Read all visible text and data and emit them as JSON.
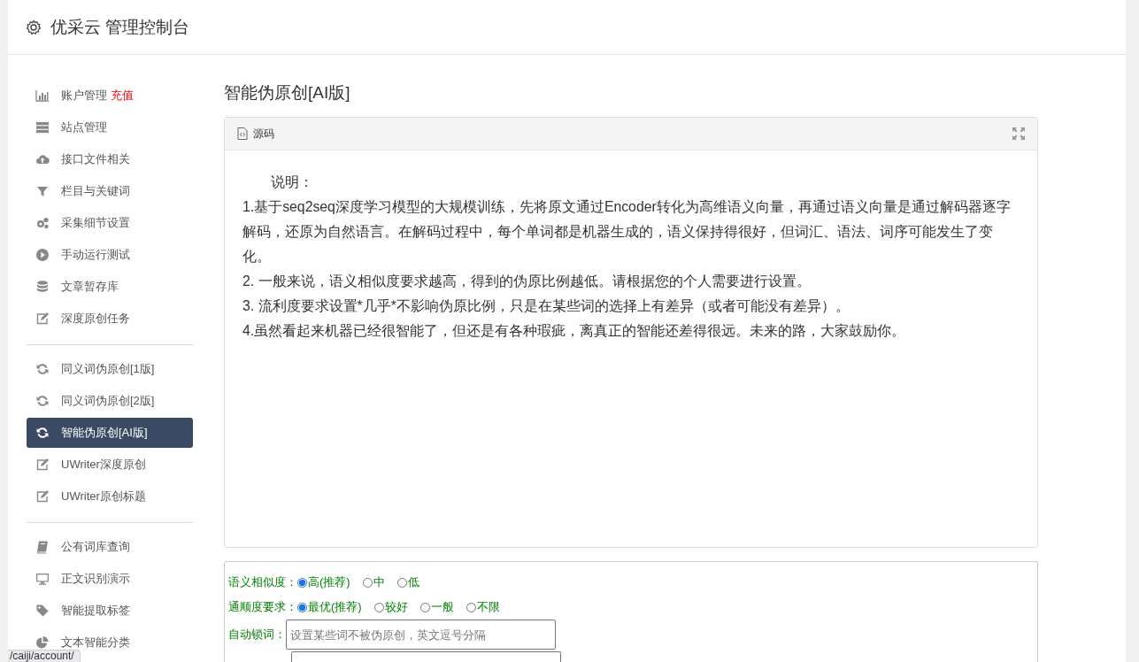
{
  "header": {
    "title": "优采云 管理控制台"
  },
  "sidebar": {
    "groups": [
      {
        "items": [
          {
            "label": "账户管理",
            "badge": "充值",
            "selected": false
          },
          {
            "label": "站点管理",
            "selected": false
          },
          {
            "label": "接口文件相关",
            "selected": false
          },
          {
            "label": "栏目与关键词",
            "selected": false
          },
          {
            "label": "采集细节设置",
            "selected": false
          },
          {
            "label": "手动运行测试",
            "selected": false
          },
          {
            "label": "文章暂存库",
            "selected": false
          },
          {
            "label": "深度原创任务",
            "selected": false
          }
        ]
      },
      {
        "items": [
          {
            "label": "同义词伪原创[1版]",
            "selected": false
          },
          {
            "label": "同义词伪原创[2版]",
            "selected": false
          },
          {
            "label": "智能伪原创[AI版]",
            "selected": true
          },
          {
            "label": "UWriter深度原创",
            "selected": false
          },
          {
            "label": "UWriter原创标题",
            "selected": false
          }
        ]
      },
      {
        "items": [
          {
            "label": "公有词库查询",
            "selected": false
          },
          {
            "label": "正文识别演示",
            "selected": false
          },
          {
            "label": "智能提取标签",
            "selected": false
          },
          {
            "label": "文本智能分类",
            "selected": false
          }
        ]
      }
    ]
  },
  "page_title": "智能伪原创[AI版]",
  "editor": {
    "tab_label": "源码",
    "heading": "说明：",
    "lines": [
      "1.基于seq2seq深度学习模型的大规模训练，先将原文通过Encoder转化为高维语义向量，再通过语义向量是通过解码器逐字解码，还原为自然语言。在解码过程中，每个单词都是机器生成的，语义保持得很好，但词汇、语法、词序可能发生了变化。",
      "2. 一般来说，语义相似度要求越高，得到的伪原比例越低。请根据您的个人需要进行设置。",
      "3. 流利度要求设置*几乎*不影响伪原比例，只是在某些词的选择上有差异（或者可能没有差异）。",
      "4.虽然看起来机器已经很智能了，但还是有各种瑕疵，离真正的智能还差得很远。未来的路，大家鼓励你。"
    ]
  },
  "options": {
    "rows": [
      {
        "kind": "radio",
        "label": "语义相似度：",
        "choices": [
          {
            "label": "高(推荐)",
            "selected": true
          },
          {
            "label": "中",
            "selected": false
          },
          {
            "label": "低",
            "selected": false
          }
        ]
      },
      {
        "kind": "radio",
        "label": "通顺度要求：",
        "choices": [
          {
            "label": "最优(推荐)",
            "selected": true
          },
          {
            "label": "较好",
            "selected": false
          },
          {
            "label": "一般",
            "selected": false
          },
          {
            "label": "不限",
            "selected": false
          }
        ]
      },
      {
        "kind": "field",
        "label": "自动锁词：",
        "placeholder": "设置某些词不被伪原创，英文逗号分隔"
      },
      {
        "kind": "textarea"
      }
    ]
  },
  "status_url": "/caiji/account/"
}
